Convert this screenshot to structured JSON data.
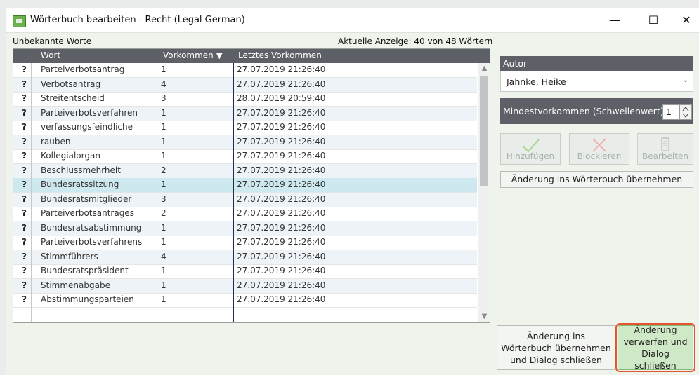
{
  "window": {
    "title": "Wörterbuch bearbeiten - Recht (Legal German)",
    "controls": {
      "minimize": "—",
      "maximize": "☐",
      "close": "✕"
    }
  },
  "list": {
    "label": "Unbekannte Worte",
    "count_text": "Aktuelle Anzeige: 40 von 48 Wörtern",
    "columns": {
      "word": "Wort",
      "count": "Vorkommen ▼",
      "last": "Letztes Vorkommen"
    },
    "rows": [
      {
        "flag": "?",
        "word": "Parteiverbotsantrag",
        "count": "1",
        "last": "27.07.2019 21:26:40"
      },
      {
        "flag": "?",
        "word": "Verbotsantrag",
        "count": "4",
        "last": "27.07.2019 21:26:40"
      },
      {
        "flag": "?",
        "word": "Streitentscheid",
        "count": "3",
        "last": "28.07.2019 20:59:40"
      },
      {
        "flag": "?",
        "word": "Parteiverbotsverfahren",
        "count": "1",
        "last": "27.07.2019 21:26:40"
      },
      {
        "flag": "?",
        "word": "verfassungsfeindliche",
        "count": "1",
        "last": "27.07.2019 21:26:40"
      },
      {
        "flag": "?",
        "word": "rauben",
        "count": "1",
        "last": "27.07.2019 21:26:40"
      },
      {
        "flag": "?",
        "word": "Kollegialorgan",
        "count": "1",
        "last": "27.07.2019 21:26:40"
      },
      {
        "flag": "?",
        "word": "Beschlussmehrheit",
        "count": "2",
        "last": "27.07.2019 21:26:40"
      },
      {
        "flag": "?",
        "word": "Bundesratssitzung",
        "count": "1",
        "last": "27.07.2019 21:26:40"
      },
      {
        "flag": "?",
        "word": "Bundesratsmitglieder",
        "count": "3",
        "last": "27.07.2019 21:26:40"
      },
      {
        "flag": "?",
        "word": "Parteiverbotsantrages",
        "count": "2",
        "last": "27.07.2019 21:26:40"
      },
      {
        "flag": "?",
        "word": "Bundesratsabstimmung",
        "count": "1",
        "last": "27.07.2019 21:26:40"
      },
      {
        "flag": "?",
        "word": "Parteiverbotsverfahrens",
        "count": "1",
        "last": "27.07.2019 21:26:40"
      },
      {
        "flag": "?",
        "word": "Stimmführers",
        "count": "4",
        "last": "27.07.2019 21:26:40"
      },
      {
        "flag": "?",
        "word": "Bundesratspräsident",
        "count": "1",
        "last": "27.07.2019 21:26:40"
      },
      {
        "flag": "?",
        "word": "Stimmenabgabe",
        "count": "1",
        "last": "27.07.2019 21:26:40"
      },
      {
        "flag": "?",
        "word": "Abstimmungsparteien",
        "count": "1",
        "last": "27.07.2019 21:26:40"
      }
    ],
    "selected_row": "Bundesratssitzung"
  },
  "panel": {
    "author_label": "Autor",
    "author_value": "Jahnke, Heike",
    "threshold_label": "Mindestvorkommen (Schwellenwert):",
    "threshold_value": "1",
    "add_label": "Hinzufügen",
    "block_label": "Blockieren",
    "edit_label": "Bearbeiten",
    "apply_label": "Änderung ins Wörterbuch übernehmen"
  },
  "footer": {
    "apply_close_label": "Änderung ins Wörterbuch übernehmen und Dialog schließen",
    "discard_close_label": "Änderung verwerfen und Dialog schließen"
  },
  "colors": {
    "header_bg": "#5d6066",
    "selected_row": "#cde8ef",
    "highlight_outline": "#e2572d",
    "discard_button_bg": "#cfe8c5"
  }
}
